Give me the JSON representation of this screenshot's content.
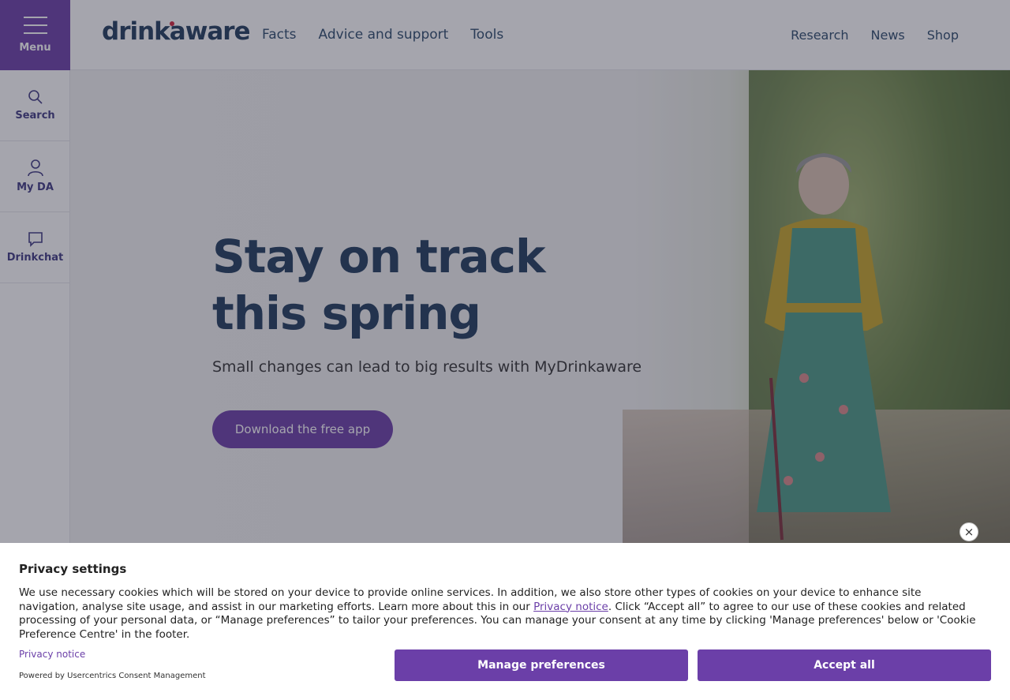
{
  "rail": {
    "menu_label": "Menu",
    "items": [
      {
        "label": "Search",
        "icon": "search-icon"
      },
      {
        "label": "My DA",
        "icon": "user-icon"
      },
      {
        "label": "Drinkchat",
        "icon": "chat-icon"
      }
    ]
  },
  "header": {
    "logo": "drinkaware",
    "nav_left": [
      "Facts",
      "Advice and support",
      "Tools"
    ],
    "nav_right": [
      "Research",
      "News",
      "Shop"
    ]
  },
  "hero": {
    "title": "Stay on track this spring",
    "subtitle": "Small changes can lead to big results with MyDrinkaware",
    "cta": "Download the free app"
  },
  "cookie_banner": {
    "close_label": "×",
    "title": "Privacy settings",
    "text_before": "We use necessary cookies which will be stored on your device to provide online services. In addition, we also store other types of cookies on your device to enhance site navigation, analyse site usage, and assist in our marketing efforts. Learn more about this in our ",
    "text_link": "Privacy notice",
    "text_after": ". Click “Accept all” to agree to our use of these cookies and related processing of your personal data, or “Manage preferences” to tailor your preferences. You can manage your consent at any time by clicking 'Manage preferences' below or 'Cookie Preference Centre' in the footer.",
    "privacy_link": "Privacy notice",
    "powered_by": "Powered by Usercentrics Consent Management",
    "manage_label": "Manage preferences",
    "accept_label": "Accept all"
  },
  "colors": {
    "brand_purple": "#6b3fa8",
    "brand_navy": "#1f3b5c",
    "logo_dot": "#d0213a"
  }
}
